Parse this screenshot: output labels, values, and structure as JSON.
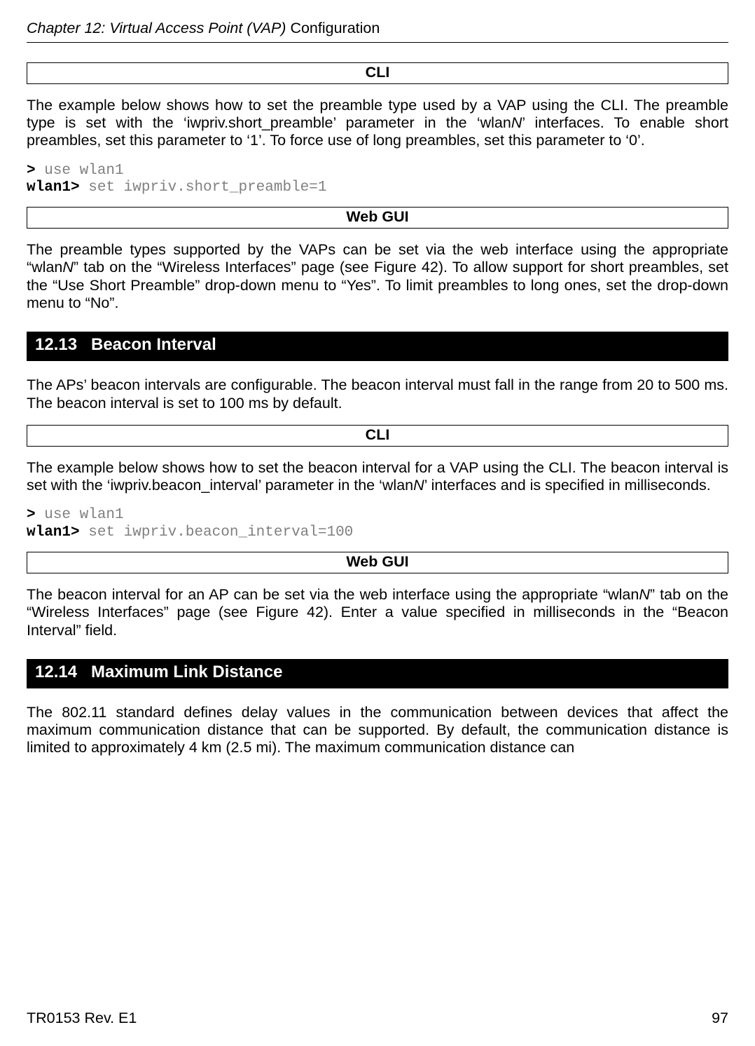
{
  "header": {
    "chapter_italic": "Chapter 12: Virtual Access Point (VAP) ",
    "chapter_plain": "Configuration"
  },
  "sec1": {
    "cli_label": "CLI",
    "para1_a": "The example below shows how to set the preamble type used by a VAP using the CLI. The preamble type is set with the ‘iwpriv.short_preamble’ parameter in the ‘wlan",
    "para1_n": "N",
    "para1_b": "’ interfaces. To enable short preambles, set this parameter to ‘1’. To force use of long preambles, set this parameter to ‘0’.",
    "cli_prompt1": "> ",
    "cli_cmd1": "use wlan1",
    "cli_prompt2": "wlan1>",
    "cli_cmd2": " set iwpriv.short_preamble=1",
    "web_label": "Web GUI",
    "para2_a": "The preamble types supported by the VAPs can be set via the web interface using the appropriate “wlan",
    "para2_n": "N",
    "para2_b": "” tab on the “Wireless Interfaces” page (see Figure 42). To allow support for short preambles, set the “Use Short Preamble” drop-down menu to “Yes”. To limit preambles to long ones, set the drop-down menu to “No”."
  },
  "sec2": {
    "number": "12.13",
    "title": "Beacon Interval",
    "intro": "The APs’ beacon intervals are configurable. The beacon interval must fall in the range from 20 to 500 ms. The beacon interval is set to 100 ms by default.",
    "cli_label": "CLI",
    "para1_a": "The example below shows how to set the beacon interval for a VAP using the CLI. The beacon interval is set with the ‘iwpriv.beacon_interval’ parameter in the ‘wlan",
    "para1_n": "N",
    "para1_b": "’ interfaces and is specified in milliseconds.",
    "cli_prompt1": "> ",
    "cli_cmd1": "use wlan1",
    "cli_prompt2": "wlan1>",
    "cli_cmd2": " set iwpriv.beacon_interval=100",
    "web_label": "Web GUI",
    "para2_a": "The beacon interval for an AP can be set via the web interface using the appropriate “wlan",
    "para2_n": "N",
    "para2_b": "” tab on the “Wireless Interfaces” page (see Figure 42). Enter a value specified in milliseconds in the “Beacon Interval” field."
  },
  "sec3": {
    "number": "12.14",
    "title": "Maximum Link Distance",
    "intro": "The 802.11 standard defines delay values in the communication between devices that affect the maximum communication distance that can be supported. By default, the communication distance is limited to approximately 4 km (2.5 mi). The maximum communication distance can"
  },
  "footer": {
    "left": "TR0153 Rev. E1",
    "right": "97"
  }
}
